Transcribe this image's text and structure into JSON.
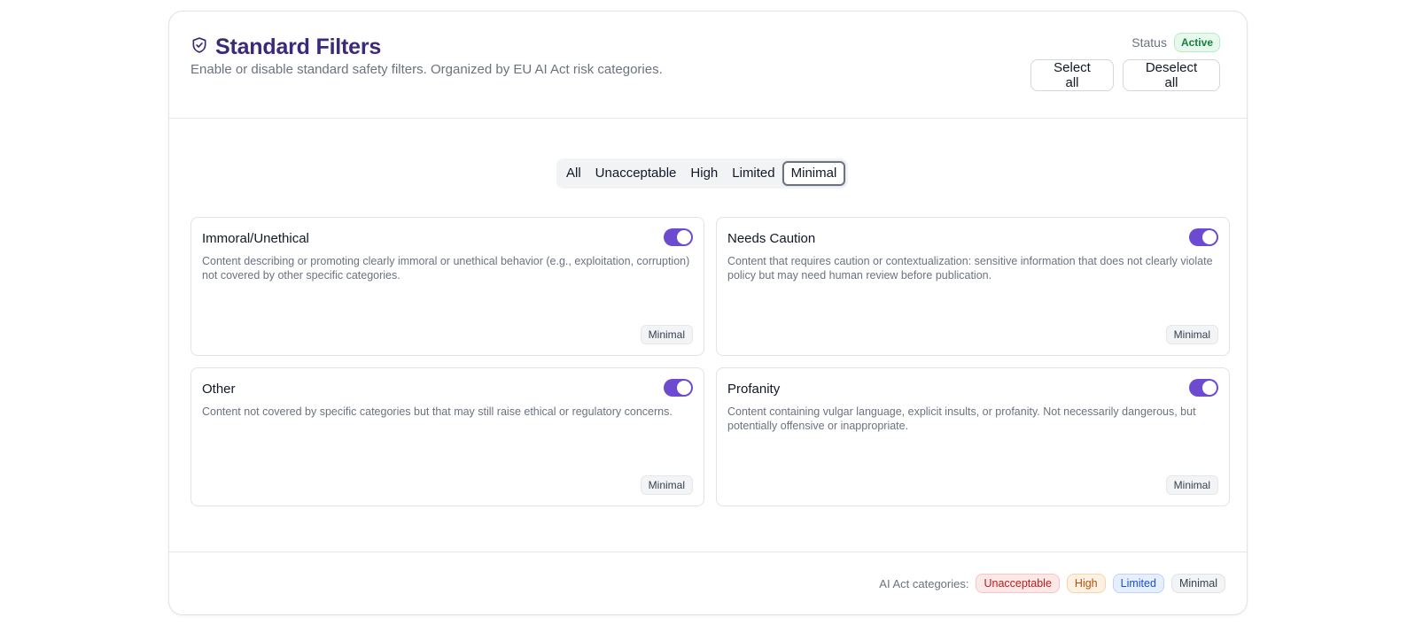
{
  "header": {
    "title": "Standard Filters",
    "subtitle": "Enable or disable standard safety filters. Organized by EU AI Act risk categories.",
    "icon": "shield-check-icon",
    "status_label": "Status",
    "status_value": "Active",
    "select_all": "Select all",
    "deselect_all": "Deselect all"
  },
  "tabs": [
    {
      "label": "All"
    },
    {
      "label": "Unacceptable"
    },
    {
      "label": "High"
    },
    {
      "label": "Limited"
    },
    {
      "label": "Minimal",
      "active": true
    }
  ],
  "cards": [
    {
      "title": "Immoral/Unethical",
      "description": "Content describing or promoting clearly immoral or unethical behavior (e.g., exploitation, corruption) not covered by other specific categories.",
      "category": "Minimal",
      "enabled": true
    },
    {
      "title": "Needs Caution",
      "description": "Content that requires caution or contextualization: sensitive information that does not clearly violate policy but may need human review before publication.",
      "category": "Minimal",
      "enabled": true
    },
    {
      "title": "Other",
      "description": "Content not covered by specific categories but that may still raise ethical or regulatory concerns.",
      "category": "Minimal",
      "enabled": true
    },
    {
      "title": "Profanity",
      "description": "Content containing vulgar language, explicit insults, or profanity. Not necessarily dangerous, but potentially offensive or inappropriate.",
      "category": "Minimal",
      "enabled": true
    }
  ],
  "footer": {
    "label": "AI Act categories:",
    "categories": [
      "Unacceptable",
      "High",
      "Limited",
      "Minimal"
    ]
  },
  "colors": {
    "accent": "#6d4bd0",
    "title": "#3b2a7a",
    "status_active": "#15803d"
  }
}
